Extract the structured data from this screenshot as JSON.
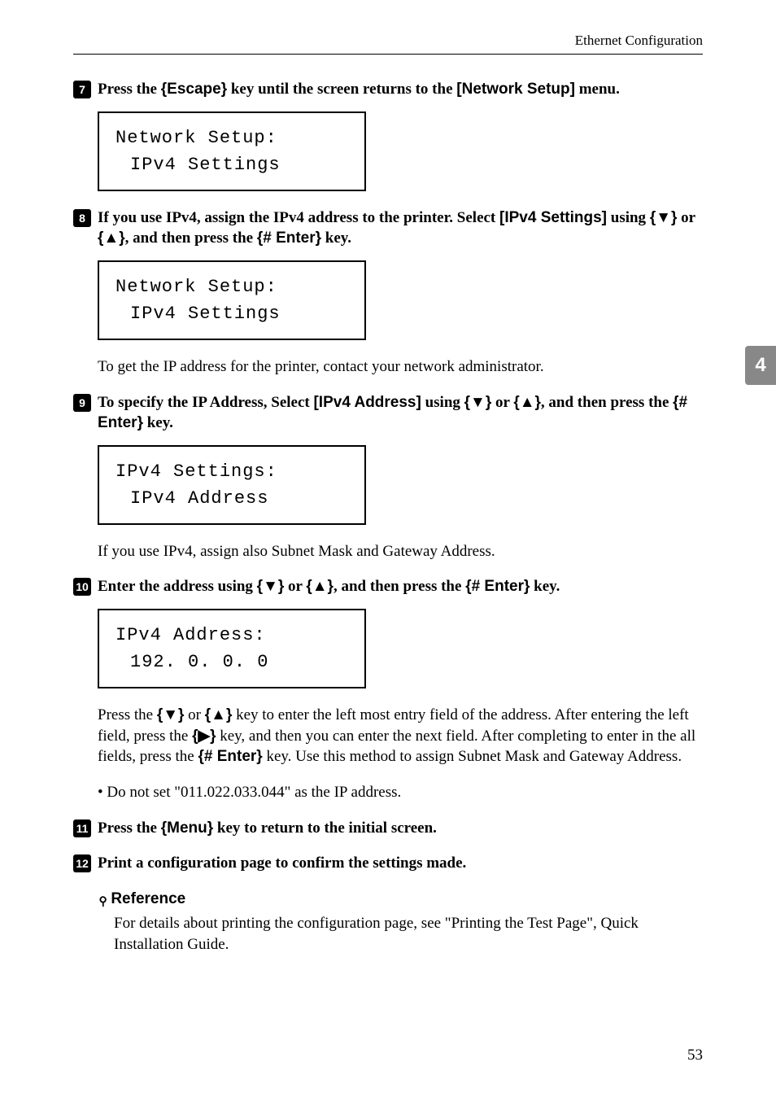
{
  "header": {
    "title": "Ethernet Configuration"
  },
  "sideTab": {
    "number": "4"
  },
  "pageNumber": "53",
  "steps": {
    "s7": {
      "num": "7",
      "text_a": "Press the ",
      "key1": "{Escape}",
      "text_b": " key until the screen returns to the ",
      "menu": "[Network Setup]",
      "text_c": " menu.",
      "lcd": {
        "line1": "Network Setup:",
        "line2": "IPv4 Settings"
      }
    },
    "s8": {
      "num": "8",
      "text_a": "If you use IPv4, assign the IPv4 address to the printer. Select ",
      "menu": "[IPv4 Settings]",
      "text_b": " using ",
      "key_down": "{▼}",
      "or1": " or ",
      "key_up": "{▲}",
      "text_c": ", and then press the ",
      "key_enter": "{# Enter}",
      "text_d": " key.",
      "lcd": {
        "line1": "Network Setup:",
        "line2": "IPv4 Settings"
      },
      "body": "To get the IP address for the printer, contact your network administrator."
    },
    "s9": {
      "num": "9",
      "text_a": "To specify the IP Address, Select ",
      "menu": "[IPv4 Address]",
      "text_b": " using ",
      "key_down": "{▼}",
      "or1": " or ",
      "key_up": "{▲}",
      "text_c": ", and then press the ",
      "key_enter": "{# Enter}",
      "text_d": " key.",
      "lcd": {
        "line1": "IPv4 Settings:",
        "line2": "IPv4 Address"
      },
      "body": "If you use IPv4, assign also Subnet Mask and Gateway Address."
    },
    "s10": {
      "num": "10",
      "text_a": "Enter the address using ",
      "key_down": "{▼}",
      "or1": " or ",
      "key_up": "{▲}",
      "text_b": ", and then press the ",
      "key_enter": "{# Enter}",
      "text_c": " key.",
      "lcd": {
        "line1": "IPv4 Address:",
        "line2": "192.  0.  0.  0"
      },
      "body_a": "Press the ",
      "bk_down": "{▼}",
      "body_or": " or ",
      "bk_up": "{▲}",
      "body_b": " key to enter the left most entry field of the address. After entering the left field, press the ",
      "bk_right": "{▶}",
      "body_c": " key, and then you can enter the next field. After completing to enter in the all fields, press the ",
      "bk_enter": "{# Enter}",
      "body_d": " key. Use this method to assign Subnet Mask and Gateway Address.",
      "bullet": "Do not set \"011.022.033.044\" as the IP address."
    },
    "s11": {
      "num": "11",
      "text_a": "Press the ",
      "key1": "{Menu}",
      "text_b": " key to return to the initial screen."
    },
    "s12": {
      "num": "12",
      "text_a": "Print a configuration page to confirm the settings made."
    }
  },
  "reference": {
    "heading": "Reference",
    "body": "For details about printing the configuration page, see \"Printing the Test Page\", Quick Installation Guide."
  }
}
